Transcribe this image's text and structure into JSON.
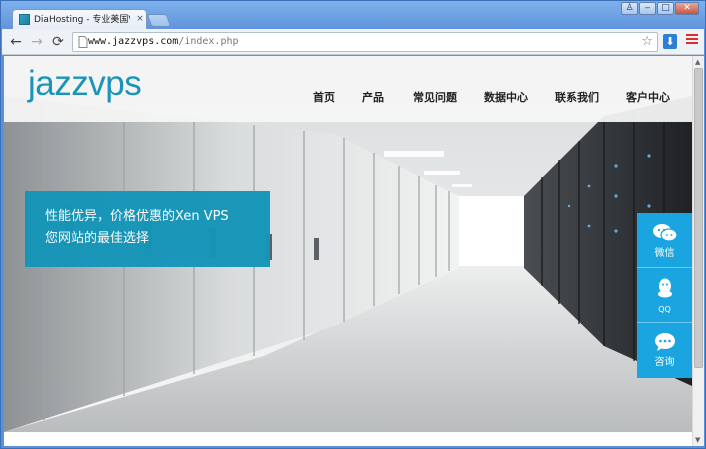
{
  "browser": {
    "tab_title": "DiaHosting - 专业美国VPS",
    "tab_close": "×",
    "url_host": "www.jazzvps.com",
    "url_path": "/index.php",
    "window_controls": {
      "user": "♙",
      "minimize": "‒",
      "maximize": "□",
      "close": "✕"
    },
    "nav": {
      "back": "←",
      "forward": "→",
      "reload": "⟳"
    },
    "star": "☆",
    "download": "⬇"
  },
  "site": {
    "logo_part1": "jazz",
    "logo_part2": "vps",
    "brand_color": "#1a94b8",
    "nav": [
      {
        "label": "首页"
      },
      {
        "label": "产品"
      },
      {
        "label": "常见问题"
      },
      {
        "label": "数据中心"
      },
      {
        "label": "联系我们"
      },
      {
        "label": "客户中心"
      }
    ],
    "promo": {
      "line1": "性能优异，价格优惠的Xen VPS",
      "line2": "您网站的最佳选择"
    },
    "side_buttons": [
      {
        "icon": "wechat-icon",
        "label": "微信"
      },
      {
        "icon": "qq-icon",
        "label": "QQ"
      },
      {
        "icon": "chat-icon",
        "label": "咨询"
      }
    ],
    "accent": "#1aa4e0"
  }
}
